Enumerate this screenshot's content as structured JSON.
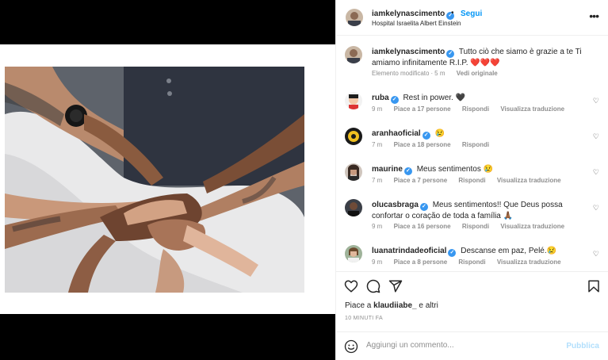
{
  "post": {
    "author": "iamkelynascimento",
    "follow_separator": "•",
    "follow_label": "Segui",
    "location": "Hospital Israelita Albert Einstein",
    "more_icon": "•••"
  },
  "caption": {
    "username": "iamkelynascimento",
    "text": "Tutto ciò che siamo è grazie a te Ti amiamo infinitamente R.I.P. ❤️❤️❤️",
    "edited": "Elemento modificato",
    "age": "5 m",
    "see_original": "Vedi originale"
  },
  "comments": [
    {
      "username": "ruba",
      "text": "Rest in power. 🖤",
      "age": "9 m",
      "likes": "Piace a 17 persone",
      "reply": "Rispondi",
      "translate": "Visualizza traduzione"
    },
    {
      "username": "aranhaoficial",
      "text": "😢",
      "age": "7 m",
      "likes": "Piace a 18 persone",
      "reply": "Rispondi",
      "translate": ""
    },
    {
      "username": "maurine",
      "text": "Meus sentimentos 😢",
      "age": "7 m",
      "likes": "Piace a 7 persone",
      "reply": "Rispondi",
      "translate": "Visualizza traduzione"
    },
    {
      "username": "olucasbraga",
      "text": "Meus sentimentos!! Que Deus possa confortar o coração de toda a família 🙏🏾",
      "age": "9 m",
      "likes": "Piace a 16 persone",
      "reply": "Rispondi",
      "translate": "Visualizza traduzione"
    },
    {
      "username": "luanatrindadeoficial",
      "text": "Descanse em paz, Pelé.😢",
      "age": "9 m",
      "likes": "Piace a 8 persone",
      "reply": "Rispondi",
      "translate": "Visualizza traduzione"
    }
  ],
  "actions": {
    "likes_prefix": "Piace a",
    "likes_user": "klaudiiabe_",
    "likes_suffix": "e altri",
    "timestamp": "10 MINUTI FA"
  },
  "composer": {
    "placeholder": "Aggiungi un commento...",
    "publish_label": "Pubblica"
  },
  "colors": {
    "accent": "#0095f6",
    "verified": "#3897f0",
    "muted": "#8e8e8e",
    "publish_disabled": "#b2dffc"
  },
  "icons": {
    "verified": "verified-badge-icon",
    "like": "heart-icon",
    "comment": "comment-icon",
    "share": "paper-plane-icon",
    "save": "bookmark-icon",
    "emoji": "smiley-icon",
    "more": "ellipsis-icon"
  }
}
